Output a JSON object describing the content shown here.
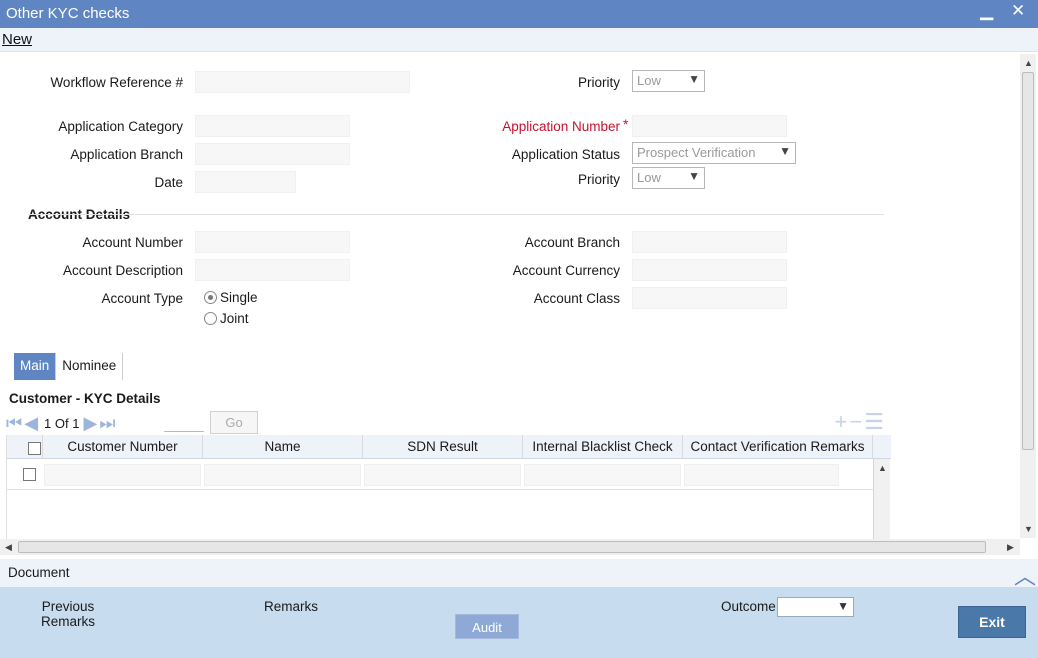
{
  "window": {
    "title": "Other KYC checks",
    "minimize": "▁",
    "close": "✕"
  },
  "menu": {
    "new_label": "New"
  },
  "header": {
    "workflow_ref_label": "Workflow Reference #",
    "priority_top_label": "Priority",
    "priority_top_value": "Low",
    "app_category_label": "Application Category",
    "app_number_label": "Application Number",
    "required_star": "*",
    "app_branch_label": "Application Branch",
    "app_status_label": "Application Status",
    "app_status_value": "Prospect Verification",
    "date_label": "Date",
    "priority_label": "Priority",
    "priority_value": "Low"
  },
  "account": {
    "section_title": "Account Details",
    "number_label": "Account Number",
    "branch_label": "Account Branch",
    "description_label": "Account Description",
    "currency_label": "Account Currency",
    "type_label": "Account Type",
    "class_label": "Account Class",
    "type_options": [
      "Single",
      "Joint"
    ],
    "type_selected": "Single"
  },
  "tabs": [
    {
      "label": "Main",
      "active": true
    },
    {
      "label": "Nominee",
      "active": false
    }
  ],
  "kyc": {
    "section_title": "Customer - KYC Details",
    "pager_text": "1 Of 1",
    "go_label": "Go",
    "columns": [
      "Customer Number",
      "Name",
      "SDN Result",
      "Internal Blacklist Check",
      "Contact Verification Remarks"
    ]
  },
  "document": {
    "label": "Document"
  },
  "footer": {
    "previous_remarks_line1": "Previous",
    "previous_remarks_line2": "Remarks",
    "remarks_label": "Remarks",
    "audit_label": "Audit",
    "outcome_label": "Outcome",
    "outcome_value": "",
    "exit_label": "Exit"
  },
  "colors": {
    "accent": "#5f86c2",
    "required": "#c8102e",
    "footer_bg": "#c7dcee",
    "exit_button": "#4a78a8"
  }
}
